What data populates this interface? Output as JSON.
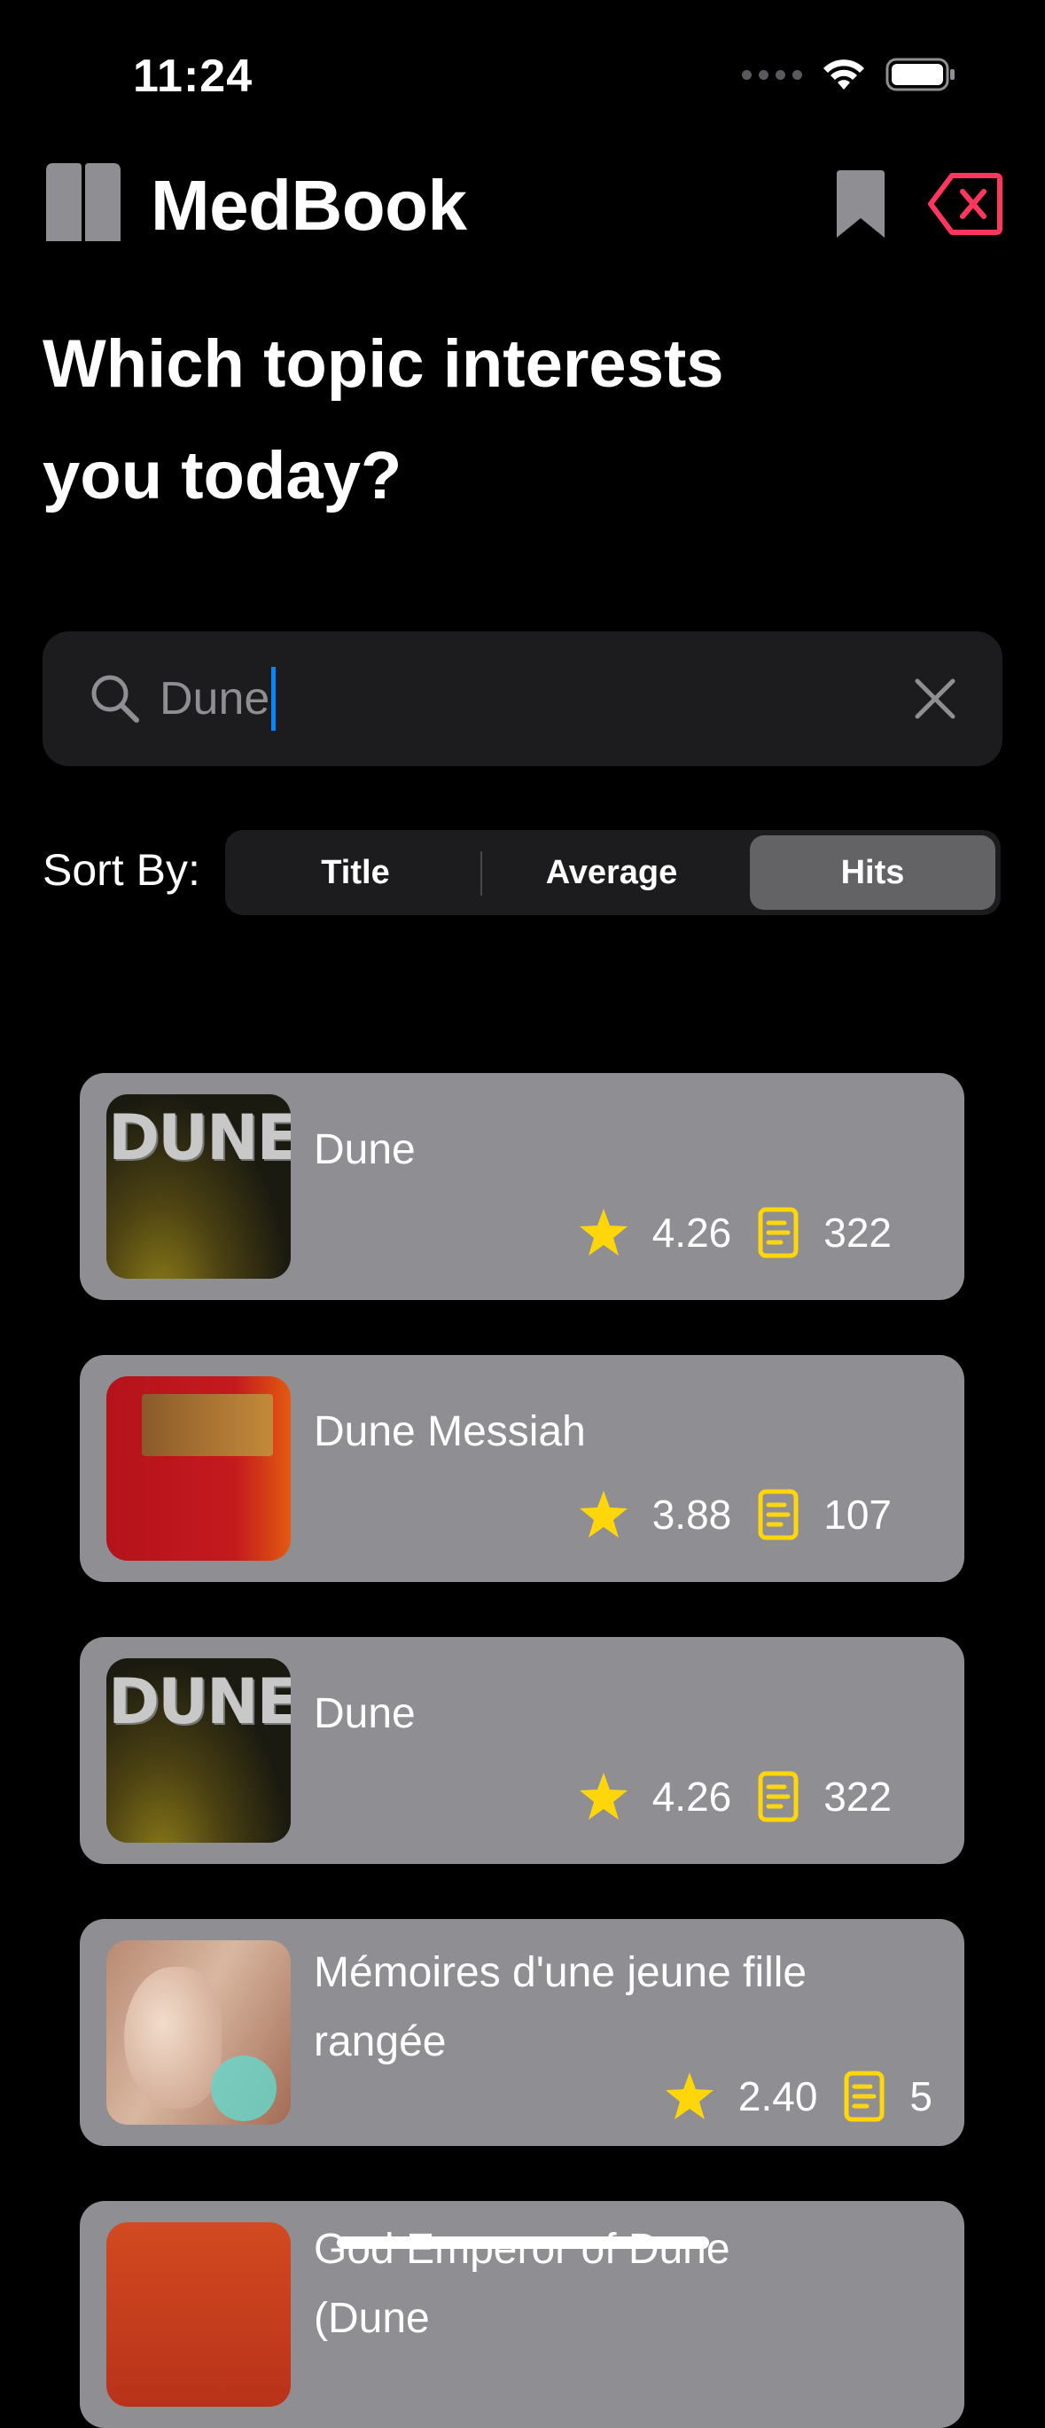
{
  "status_bar": {
    "time": "11:24"
  },
  "header": {
    "app_title": "MedBook",
    "logo_icon": "books-icon",
    "bookmark_icon": "bookmark-icon",
    "logout_icon": "delete-left-icon",
    "accent_color": "#ff375f"
  },
  "heading": {
    "line1": "Which topic interests",
    "line2": "you today?"
  },
  "search": {
    "value": "Dune",
    "placeholder": "",
    "clear_icon": "xmark-icon"
  },
  "sort": {
    "label": "Sort By:",
    "options": [
      "Title",
      "Average",
      "Hits"
    ],
    "selected": "Hits"
  },
  "results": [
    {
      "title": "Dune",
      "rating": "4.26",
      "count": "322",
      "cover": "dune"
    },
    {
      "title": "Dune Messiah",
      "rating": "3.88",
      "count": "107",
      "cover": "messiah"
    },
    {
      "title": "Dune",
      "rating": "4.26",
      "count": "322",
      "cover": "dune"
    },
    {
      "title": "Mémoires d'une jeune fille rangée",
      "rating": "2.40",
      "count": "5",
      "cover": "memoires"
    },
    {
      "title": "God Emperor of Dune (Dune",
      "rating": "",
      "count": "",
      "cover": "emperor"
    }
  ],
  "colors": {
    "star": "#ffd60a",
    "card_bg": "#8e8e93",
    "segment_selected": "#636366"
  }
}
